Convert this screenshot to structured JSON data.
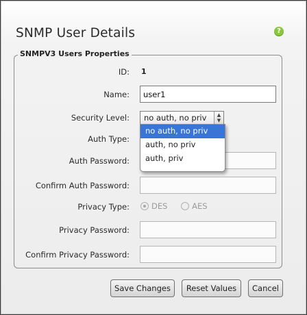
{
  "dialog": {
    "title": "SNMP User Details",
    "help_icon": "?"
  },
  "section": {
    "legend": "SNMPV3 Users Properties"
  },
  "fields": {
    "id": {
      "label": "ID:",
      "value": "1"
    },
    "name": {
      "label": "Name:",
      "value": "user1"
    },
    "security_level": {
      "label": "Security Level:",
      "selected": "no auth, no priv",
      "options": [
        "no auth, no priv",
        "auth, no priv",
        "auth, priv"
      ]
    },
    "auth_type": {
      "label": "Auth Type:"
    },
    "auth_password": {
      "label": "Auth Password:",
      "value": ""
    },
    "confirm_auth_password": {
      "label": "Confirm Auth Password:",
      "value": ""
    },
    "privacy_type": {
      "label": "Privacy Type:",
      "options": [
        "DES",
        "AES"
      ],
      "selected": "DES"
    },
    "privacy_password": {
      "label": "Privacy Password:",
      "value": ""
    },
    "confirm_privacy_password": {
      "label": "Confirm Privacy Password:",
      "value": ""
    }
  },
  "buttons": {
    "save": "Save Changes",
    "reset": "Reset Values",
    "cancel": "Cancel"
  },
  "icons": {
    "help": "help-icon",
    "select_arrow": "updown-arrow-icon"
  },
  "colors": {
    "help_green": "#8cc63f",
    "selection_blue": "#3875d7"
  }
}
